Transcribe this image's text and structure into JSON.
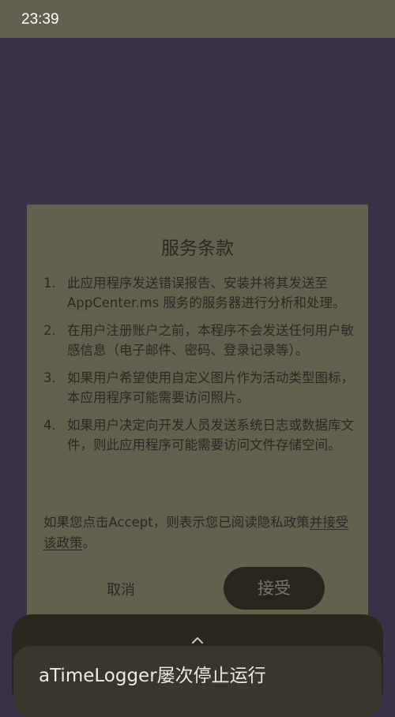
{
  "status_bar": {
    "time": "23:39"
  },
  "dialog": {
    "title": "服务条款",
    "terms": [
      {
        "number": "1.",
        "text": "此应用程序发送错误报告、安装并将其发送至 AppCenter.ms 服务的服务器进行分析和处理。"
      },
      {
        "number": "2.",
        "text": "在用户注册账户之前，本程序不会发送任何用户敏感信息（电子邮件、密码、登录记录等）。"
      },
      {
        "number": "3.",
        "text": "如果用户希望使用自定义图片作为活动类型图标，本应用程序可能需要访问照片。"
      },
      {
        "number": "4.",
        "text": "如果用户决定向开发人员发送系统日志或数据库文件，则此应用程序可能需要访问文件存储空间。"
      }
    ],
    "privacy_text": "如果您点击Accept，则表示您已阅读隐私政策",
    "privacy_link": "并接受该政策",
    "privacy_end": "。",
    "cancel_label": "取消",
    "accept_label": "接受"
  },
  "crash_notice": {
    "icon": "chevron-up-icon",
    "message": "aTimeLogger屡次停止运行"
  }
}
